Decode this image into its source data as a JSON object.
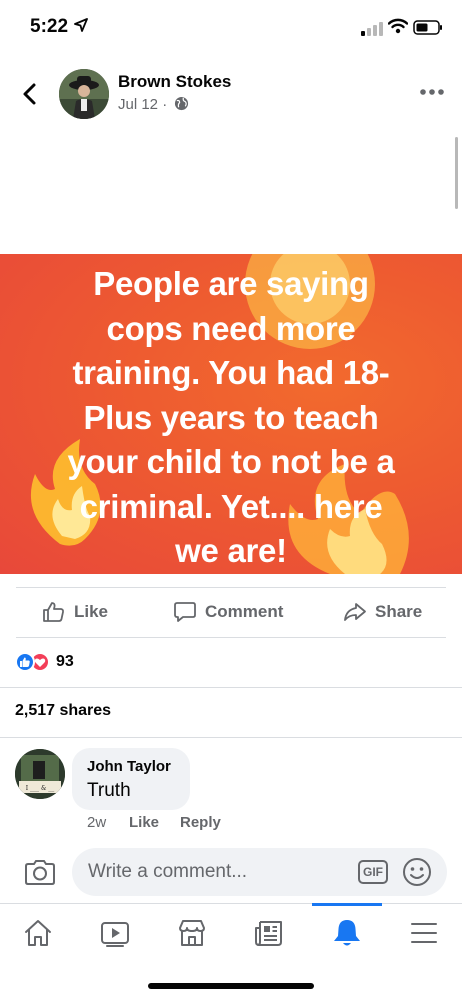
{
  "status_bar": {
    "time": "5:22"
  },
  "post": {
    "author": "Brown Stokes",
    "date": "Jul 12",
    "separator": "·",
    "image_text_lines": [
      "People are saying",
      "cops need more",
      "training.  You had 18-",
      "Plus years to teach",
      "your child to not be a",
      "criminal.  Yet.... here",
      "we are!"
    ],
    "image_colors": {
      "background": "#ee5c30",
      "text": "#ffffff"
    }
  },
  "actions": {
    "like": "Like",
    "comment": "Comment",
    "share": "Share"
  },
  "reactions": {
    "count": "93",
    "types": [
      "like",
      "love"
    ],
    "colors": {
      "like": "#1877f2",
      "love": "#f33e58"
    }
  },
  "shares": "2,517 shares",
  "comment": {
    "author": "John Taylor",
    "text": "Truth",
    "time": "2w",
    "like": "Like",
    "reply": "Reply"
  },
  "composer": {
    "placeholder": "Write a comment...",
    "gif": "GIF"
  },
  "tabbar": {
    "tabs": [
      "home-icon",
      "video-icon",
      "marketplace-icon",
      "news-icon",
      "notifications-icon",
      "menu-icon"
    ],
    "active": "notifications-icon",
    "accent": "#1877f2"
  }
}
